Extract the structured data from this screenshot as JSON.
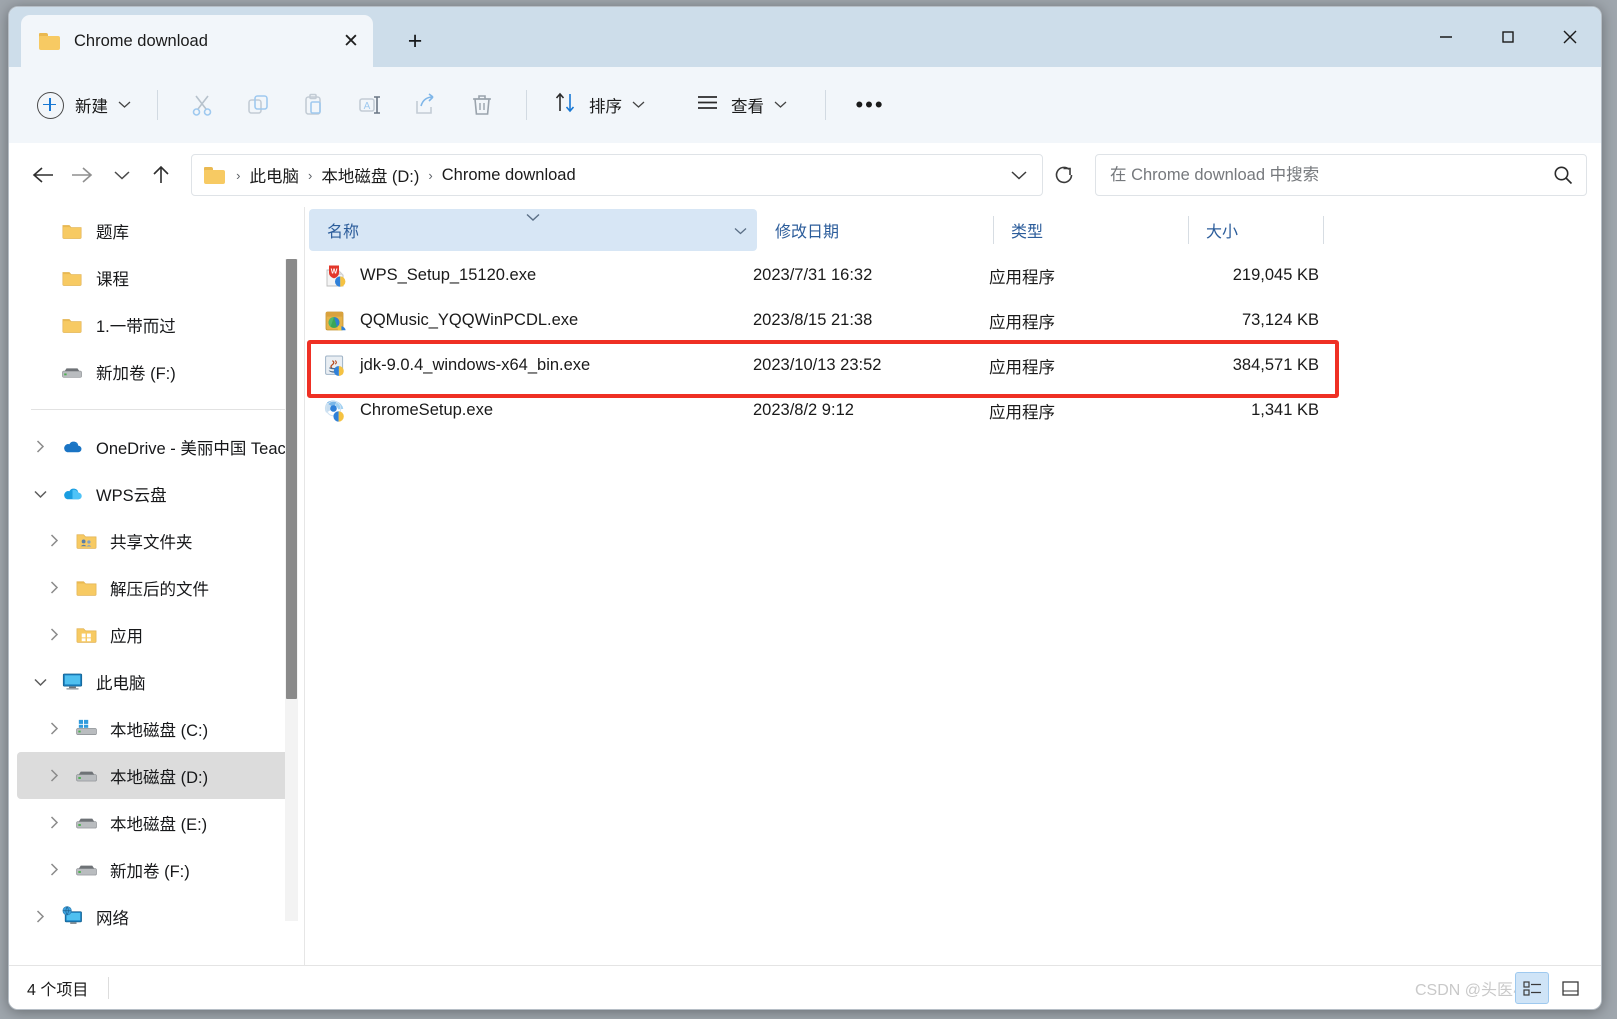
{
  "window": {
    "tab_title": "Chrome download",
    "tab_close_label": "✕",
    "new_tab_label": "+",
    "minimize_label": "minimize",
    "maximize_label": "maximize",
    "close_label": "close"
  },
  "toolbar": {
    "new_label": "新建",
    "cut_label": "剪切",
    "copy_label": "复制",
    "paste_label": "粘贴",
    "rename_label": "重命名",
    "share_label": "共享",
    "delete_label": "删除",
    "sort_label": "排序",
    "view_label": "查看",
    "more_label": "•••"
  },
  "address": {
    "back_label": "←",
    "forward_label": "→",
    "recent_label": "∨",
    "up_label": "↑",
    "crumbs": [
      "此电脑",
      "本地磁盘 (D:)",
      "Chrome download"
    ],
    "separator": "›",
    "refresh_label": "↻"
  },
  "search": {
    "placeholder": "在 Chrome download 中搜索",
    "value": ""
  },
  "sidebar": {
    "quick": [
      {
        "label": "题库",
        "icon": "folder-icon",
        "chevron": false
      },
      {
        "label": "课程",
        "icon": "folder-icon",
        "chevron": false
      },
      {
        "label": "1.一带而过",
        "icon": "folder-icon",
        "chevron": false
      },
      {
        "label": "新加卷 (F:)",
        "icon": "drive-icon",
        "chevron": false
      }
    ],
    "tree": [
      {
        "label": "OneDrive - 美丽中国 Teac",
        "icon": "onedrive-icon",
        "chevron": "›",
        "indent": 0,
        "selected": false
      },
      {
        "label": "WPS云盘",
        "icon": "wps-cloud-icon",
        "chevron": "⌄",
        "indent": 0,
        "selected": false
      },
      {
        "label": "共享文件夹",
        "icon": "shared-folder-icon",
        "chevron": "›",
        "indent": 1,
        "selected": false
      },
      {
        "label": "解压后的文件",
        "icon": "folder-icon",
        "chevron": "›",
        "indent": 1,
        "selected": false
      },
      {
        "label": "应用",
        "icon": "apps-folder-icon",
        "chevron": "›",
        "indent": 1,
        "selected": false
      },
      {
        "label": "此电脑",
        "icon": "this-pc-icon",
        "chevron": "⌄",
        "indent": 0,
        "selected": false
      },
      {
        "label": "本地磁盘 (C:)",
        "icon": "windows-drive-icon",
        "chevron": "›",
        "indent": 1,
        "selected": false
      },
      {
        "label": "本地磁盘 (D:)",
        "icon": "drive-icon",
        "chevron": "›",
        "indent": 1,
        "selected": true
      },
      {
        "label": "本地磁盘 (E:)",
        "icon": "drive-icon",
        "chevron": "›",
        "indent": 1,
        "selected": false
      },
      {
        "label": "新加卷 (F:)",
        "icon": "drive-icon",
        "chevron": "›",
        "indent": 1,
        "selected": false
      },
      {
        "label": "网络",
        "icon": "network-icon",
        "chevron": "›",
        "indent": 0,
        "selected": false
      }
    ]
  },
  "filelist": {
    "columns": [
      {
        "label": "名称",
        "sorted": true
      },
      {
        "label": "修改日期",
        "sorted": false
      },
      {
        "label": "类型",
        "sorted": false
      },
      {
        "label": "大小",
        "sorted": false
      }
    ],
    "rows": [
      {
        "name": "WPS_Setup_15120.exe",
        "date": "2023/7/31 16:32",
        "type": "应用程序",
        "size": "219,045 KB",
        "icon": "wps-setup-icon",
        "highlighted": false
      },
      {
        "name": "QQMusic_YQQWinPCDL.exe",
        "date": "2023/8/15 21:38",
        "type": "应用程序",
        "size": "73,124 KB",
        "icon": "qqmusic-icon",
        "highlighted": false
      },
      {
        "name": "jdk-9.0.4_windows-x64_bin.exe",
        "date": "2023/10/13 23:52",
        "type": "应用程序",
        "size": "384,571 KB",
        "icon": "java-icon",
        "highlighted": true
      },
      {
        "name": "ChromeSetup.exe",
        "date": "2023/8/2 9:12",
        "type": "应用程序",
        "size": "1,341 KB",
        "icon": "chrome-icon",
        "highlighted": false
      }
    ]
  },
  "statusbar": {
    "item_count": "4 个项目",
    "watermark": "CSDN @头医小宇"
  },
  "colors": {
    "titlebar": "#cdddea",
    "toolbar": "#f2f6fa",
    "accent_blue": "#1878d4",
    "header_text": "#2c5d9b",
    "name_col_bg": "#d7e6f5",
    "highlight_red": "#ef3024",
    "selection_grey": "#dcdcdc"
  }
}
